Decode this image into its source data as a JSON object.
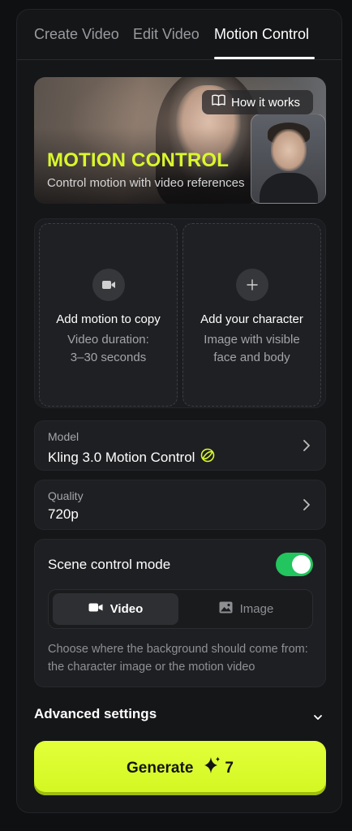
{
  "tabs": [
    {
      "label": "Create Video",
      "active": false
    },
    {
      "label": "Edit Video",
      "active": false
    },
    {
      "label": "Motion Control",
      "active": true
    }
  ],
  "hero": {
    "how_it_works": "How it works",
    "title": "MOTION CONTROL",
    "subtitle": "Control motion with video references"
  },
  "uploads": [
    {
      "icon": "video-camera-icon",
      "title": "Add motion to copy",
      "line1": "Video duration:",
      "line2": "3–30 seconds"
    },
    {
      "icon": "plus-icon",
      "title": "Add your character",
      "line1": "Image with visible",
      "line2": "face and body"
    }
  ],
  "model": {
    "label": "Model",
    "value": "Kling 3.0 Motion Control"
  },
  "quality": {
    "label": "Quality",
    "value": "720p"
  },
  "scene": {
    "title": "Scene control mode",
    "toggle_on": true,
    "options": [
      {
        "label": "Video",
        "selected": true
      },
      {
        "label": "Image",
        "selected": false
      }
    ],
    "description": "Choose where the background should come from: the character image or the motion video"
  },
  "advanced": {
    "label": "Advanced settings"
  },
  "generate": {
    "label": "Generate",
    "cost": "7"
  },
  "colors": {
    "accent": "#d9f82c",
    "toggle": "#22c55e",
    "background": "#151618"
  }
}
